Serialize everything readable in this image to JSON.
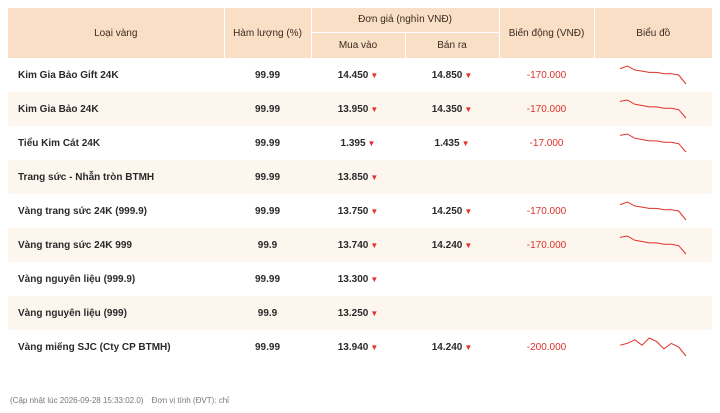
{
  "headers": {
    "type": "Loại vàng",
    "purity": "Hàm lượng (%)",
    "price_group": "Đơn giá (nghìn VNĐ)",
    "buy": "Mua vào",
    "sell": "Bán ra",
    "change": "Biến động (VNĐ)",
    "chart": "Biểu đồ"
  },
  "rows": [
    {
      "name": "Kim Gia Bảo Gift 24K",
      "purity": "99.99",
      "buy": "14.450",
      "sell": "14.850",
      "change": "-170.000",
      "trend": [
        6,
        4,
        7,
        8,
        9,
        9,
        10,
        10,
        11,
        18
      ]
    },
    {
      "name": "Kim Gia Bảo 24K",
      "purity": "99.99",
      "buy": "13.950",
      "sell": "14.350",
      "change": "-170.000",
      "trend": [
        6,
        5,
        8,
        9,
        10,
        10,
        11,
        11,
        12,
        18
      ]
    },
    {
      "name": "Tiểu Kim Cát 24K",
      "purity": "99.99",
      "buy": "1.395",
      "sell": "1.435",
      "change": "-17.000",
      "trend": [
        6,
        5,
        8,
        9,
        10,
        10,
        11,
        11,
        12,
        18
      ]
    },
    {
      "name": "Trang sức - Nhẫn tròn BTMH",
      "purity": "99.99",
      "buy": "13.850",
      "sell": "",
      "change": "",
      "trend": []
    },
    {
      "name": "Vàng trang sức 24K (999.9)",
      "purity": "99.99",
      "buy": "13.750",
      "sell": "14.250",
      "change": "-170.000",
      "trend": [
        6,
        4,
        7,
        8,
        9,
        9,
        10,
        10,
        11,
        18
      ]
    },
    {
      "name": "Vàng trang sức 24K 999",
      "purity": "99.9",
      "buy": "13.740",
      "sell": "14.240",
      "change": "-170.000",
      "trend": [
        6,
        5,
        8,
        9,
        10,
        10,
        11,
        11,
        12,
        18
      ]
    },
    {
      "name": "Vàng nguyên liệu (999.9)",
      "purity": "99.99",
      "buy": "13.300",
      "sell": "",
      "change": "",
      "trend": []
    },
    {
      "name": "Vàng nguyên liệu (999)",
      "purity": "99.9",
      "buy": "13.250",
      "sell": "",
      "change": "",
      "trend": []
    },
    {
      "name": "Vàng miếng SJC (Cty CP BTMH)",
      "purity": "99.99",
      "buy": "13.940",
      "sell": "14.240",
      "change": "-200.000",
      "trend": [
        12,
        11,
        9,
        12,
        8,
        10,
        14,
        11,
        13,
        18
      ]
    }
  ],
  "arrow_glyph": "▼",
  "footer": {
    "updated": "(Cập nhật lúc 2026-09-28 15:33:02.0)",
    "unit": "Đơn vị tính (ĐVT): chỉ"
  },
  "colors": {
    "header_bg": "#f8dfc6",
    "row_alt_bg": "#fdf6ef",
    "down_red": "#e0312b"
  }
}
